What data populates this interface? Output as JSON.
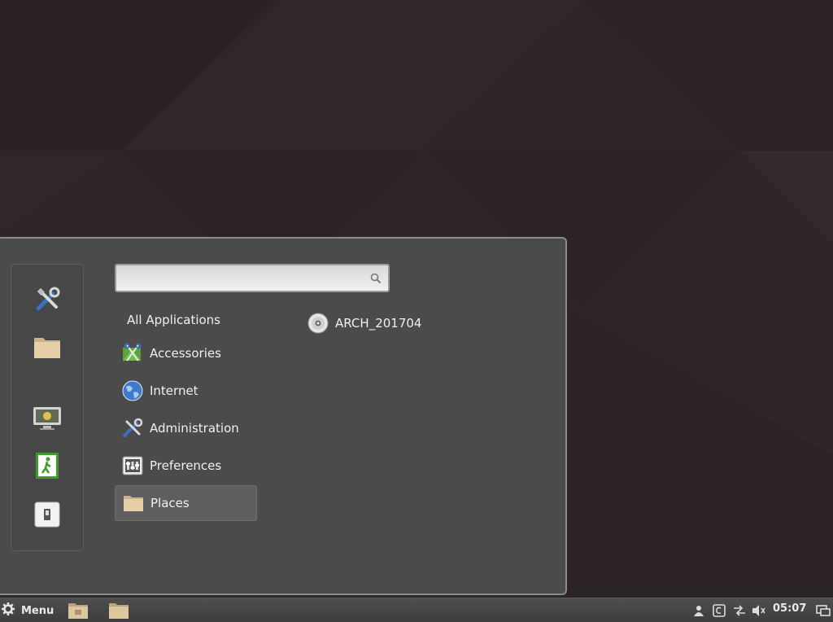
{
  "search": {
    "placeholder": "",
    "value": ""
  },
  "categories": [
    {
      "label": "All Applications",
      "icon": "none"
    },
    {
      "label": "Accessories",
      "icon": "accessories-icon"
    },
    {
      "label": "Internet",
      "icon": "globe-icon"
    },
    {
      "label": "Administration",
      "icon": "tools-icon"
    },
    {
      "label": "Preferences",
      "icon": "preferences-icon"
    },
    {
      "label": "Places",
      "icon": "folder-icon",
      "selected": true
    }
  ],
  "places": [
    {
      "label": "ARCH_201704",
      "icon": "optical-disc-icon"
    }
  ],
  "favorites": [
    "tools-icon",
    "folder-icon",
    "lock-screen-icon",
    "logout-icon",
    "shutdown-icon"
  ],
  "panel": {
    "menu_label": "Menu",
    "clock": "05:07",
    "tray_icons": [
      "user-icon",
      "clipboard-icon",
      "network-icon",
      "volume-icon",
      "workspace-icon"
    ]
  },
  "colors": {
    "menu_bg": "#4b4b4b",
    "selected_bg": "#5f5f5f",
    "desktop_bg": "#2f2628",
    "panel_bg": "#454545"
  }
}
